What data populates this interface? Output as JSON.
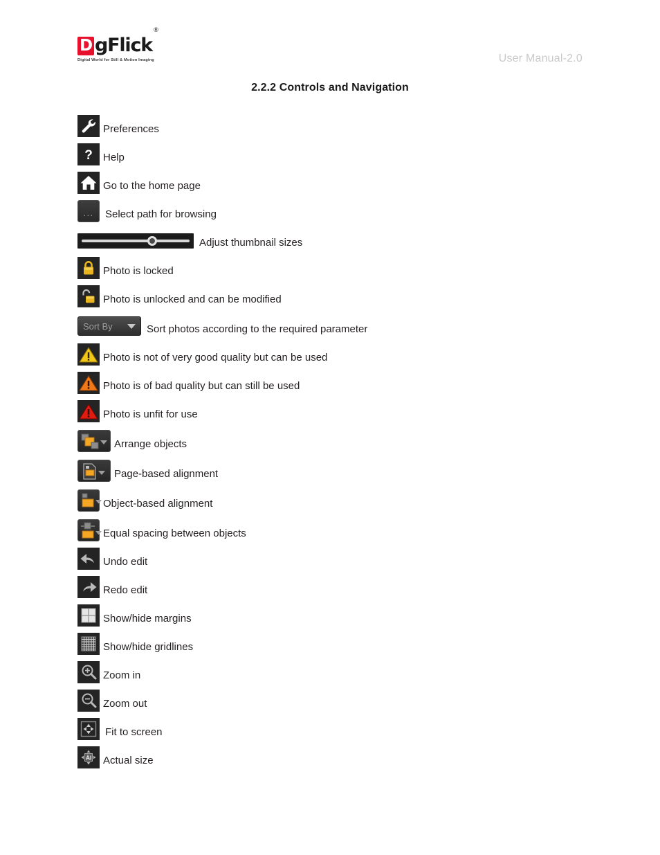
{
  "header": {
    "logo_d": "D",
    "logo_rest": "gFlick",
    "logo_registered": "®",
    "logo_tagline": "Digital World for Still & Motion Imaging",
    "manual_label": "User Manual-2.0"
  },
  "section": {
    "title": "2.2.2 Controls and Navigation"
  },
  "colors": {
    "brand_red": "#e8112d",
    "icon_background": "#242424",
    "accent_orange": "#f5a623",
    "lock_gold": "#e8b51e",
    "warning_yellow": "#f2c818",
    "warning_orange": "#f07818",
    "warning_red": "#e01b10",
    "header_gray": "#c9c9c9"
  },
  "legend": {
    "rows": [
      {
        "icon": "wrench-icon",
        "label": "Preferences"
      },
      {
        "icon": "help-question-icon",
        "label": "Help"
      },
      {
        "icon": "home-icon",
        "label": "Go to the home page"
      },
      {
        "icon": "browse-ellipsis-button",
        "label": "Select path for browsing",
        "dots": "..."
      },
      {
        "icon": "thumbnail-size-slider",
        "label": "Adjust thumbnail sizes"
      },
      {
        "icon": "lock-closed-icon",
        "label": "Photo is locked"
      },
      {
        "icon": "lock-open-icon",
        "label": "Photo is unlocked and can be modified"
      },
      {
        "icon": "sort-by-dropdown",
        "label": "Sort photos according to the required parameter",
        "button_text": "Sort By"
      },
      {
        "icon": "warning-yellow-icon",
        "label": "Photo is not of very good quality but can be used"
      },
      {
        "icon": "warning-orange-icon",
        "label": "Photo is of bad quality but can still be used"
      },
      {
        "icon": "warning-red-icon",
        "label": "Photo is unfit for use"
      },
      {
        "icon": "arrange-objects-icon",
        "label": "Arrange objects"
      },
      {
        "icon": "page-alignment-icon",
        "label": "Page-based alignment"
      },
      {
        "icon": "object-alignment-icon",
        "label": "Object-based alignment"
      },
      {
        "icon": "equal-spacing-icon",
        "label": "Equal spacing between objects"
      },
      {
        "icon": "undo-icon",
        "label": "Undo edit"
      },
      {
        "icon": "redo-icon",
        "label": "Redo edit"
      },
      {
        "icon": "margins-icon",
        "label": "Show/hide margins"
      },
      {
        "icon": "gridlines-icon",
        "label": "Show/hide gridlines"
      },
      {
        "icon": "zoom-in-icon",
        "label": "Zoom in"
      },
      {
        "icon": "zoom-out-icon",
        "label": "Zoom out"
      },
      {
        "icon": "fit-to-screen-icon",
        "label": "Fit to screen"
      },
      {
        "icon": "actual-size-icon",
        "label": "Actual size"
      }
    ]
  }
}
